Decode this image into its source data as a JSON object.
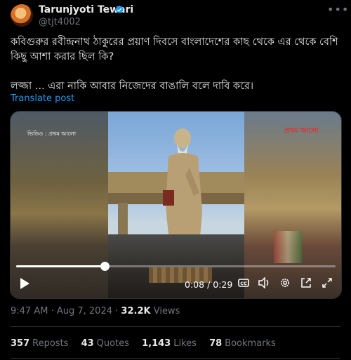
{
  "author": {
    "name": "Tarunjyoti Tewari",
    "handle": "@tjt4002",
    "verified_color": "#1d9bf0"
  },
  "post": {
    "text_line1": "কবিগুরুর রবীন্দ্রনাথ ঠাকুরের প্রয়াণ দিবসে বাংলাদেশের কাছ থেকে এর থেকে বেশি কিছু আশা করার ছিল কি?",
    "text_line2": "লজ্জা ... এরা নাকি আবার নিজেদের বাঙালি বলে দাবি করে।",
    "translate_label": "Translate post"
  },
  "media": {
    "credit_text": "ভিডিও : প্রথম আলো",
    "brand_text": "প্রথম আলো",
    "current_time": "0:08",
    "duration": "0:29",
    "progress_fraction": 0.2759,
    "icons": [
      "play-icon",
      "cc-icon",
      "volume-icon",
      "settings-icon",
      "popout-icon",
      "fullscreen-icon"
    ]
  },
  "meta": {
    "time": "9:47 AM",
    "date": "Aug 7, 2024",
    "separator": "·",
    "views_count": "32.2K",
    "views_label": "Views"
  },
  "stats": {
    "reposts_count": "357",
    "reposts_label": "Reposts",
    "quotes_count": "43",
    "quotes_label": "Quotes",
    "likes_count": "1,143",
    "likes_label": "Likes",
    "bookmarks_count": "78",
    "bookmarks_label": "Bookmarks"
  },
  "colors": {
    "background": "#000000",
    "text": "#e7e9ea",
    "muted": "#71767b",
    "accent": "#1d9bf0",
    "divider": "#2f3336"
  }
}
